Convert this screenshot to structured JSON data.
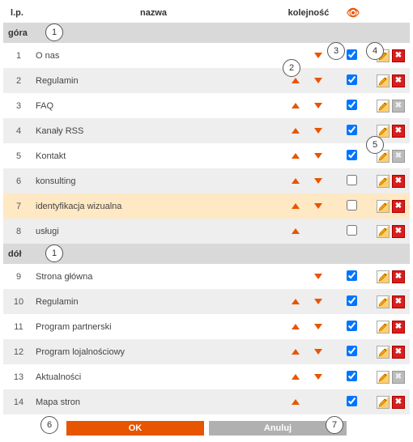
{
  "headers": {
    "lp": "l.p.",
    "name": "nazwa",
    "order": "kolejność",
    "visibility_icon": "eye-icon"
  },
  "sections": [
    {
      "title": "góra",
      "callout": "1",
      "rows": [
        {
          "lp": "1",
          "name": "O nas",
          "up": false,
          "down": true,
          "checked": true,
          "delete_enabled": true
        },
        {
          "lp": "2",
          "name": "Regulamin",
          "up": true,
          "down": true,
          "checked": true,
          "delete_enabled": true
        },
        {
          "lp": "3",
          "name": "FAQ",
          "up": true,
          "down": true,
          "checked": true,
          "delete_enabled": false
        },
        {
          "lp": "4",
          "name": "Kanały RSS",
          "up": true,
          "down": true,
          "checked": true,
          "delete_enabled": true
        },
        {
          "lp": "5",
          "name": "Kontakt",
          "up": true,
          "down": true,
          "checked": true,
          "delete_enabled": false
        },
        {
          "lp": "6",
          "name": "konsulting",
          "up": true,
          "down": true,
          "checked": false,
          "delete_enabled": true
        },
        {
          "lp": "7",
          "name": "identyfikacja wizualna",
          "up": true,
          "down": true,
          "checked": false,
          "delete_enabled": true,
          "highlight": true
        },
        {
          "lp": "8",
          "name": "usługi",
          "up": true,
          "down": false,
          "checked": false,
          "delete_enabled": true
        }
      ]
    },
    {
      "title": "dół",
      "callout": "1",
      "rows": [
        {
          "lp": "9",
          "name": "Strona główna",
          "up": false,
          "down": true,
          "checked": true,
          "delete_enabled": true
        },
        {
          "lp": "10",
          "name": "Regulamin",
          "up": true,
          "down": true,
          "checked": true,
          "delete_enabled": true
        },
        {
          "lp": "11",
          "name": "Program partnerski",
          "up": true,
          "down": true,
          "checked": true,
          "delete_enabled": true
        },
        {
          "lp": "12",
          "name": "Program lojalnościowy",
          "up": true,
          "down": true,
          "checked": true,
          "delete_enabled": true
        },
        {
          "lp": "13",
          "name": "Aktualności",
          "up": true,
          "down": true,
          "checked": true,
          "delete_enabled": false
        },
        {
          "lp": "14",
          "name": "Mapa stron",
          "up": true,
          "down": false,
          "checked": true,
          "delete_enabled": true
        }
      ]
    }
  ],
  "callouts": {
    "c2": "2",
    "c3": "3",
    "c4": "4",
    "c5": "5",
    "c6": "6",
    "c7": "7"
  },
  "footer": {
    "ok": "OK",
    "cancel": "Anuluj"
  }
}
